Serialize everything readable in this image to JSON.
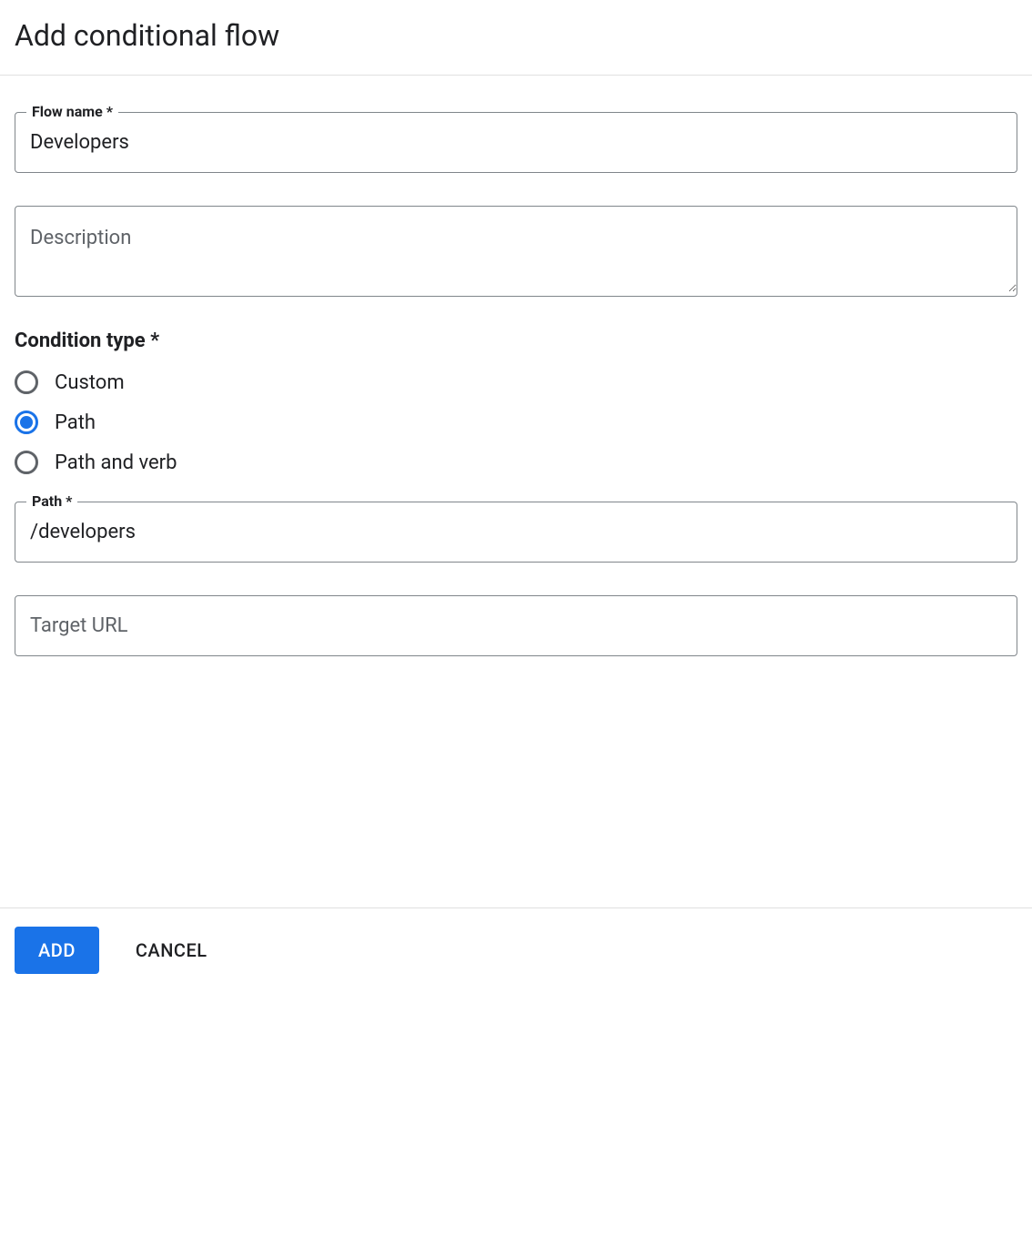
{
  "header": {
    "title": "Add conditional flow"
  },
  "form": {
    "flow_name": {
      "label": "Flow name *",
      "value": "Developers"
    },
    "description": {
      "placeholder": "Description",
      "value": ""
    },
    "condition_type": {
      "label": "Condition type *",
      "options": [
        {
          "label": "Custom",
          "selected": false
        },
        {
          "label": "Path",
          "selected": true
        },
        {
          "label": "Path and verb",
          "selected": false
        }
      ]
    },
    "path": {
      "label": "Path *",
      "value": "/developers"
    },
    "target_url": {
      "placeholder": "Target URL",
      "value": ""
    }
  },
  "footer": {
    "add_label": "ADD",
    "cancel_label": "CANCEL"
  }
}
